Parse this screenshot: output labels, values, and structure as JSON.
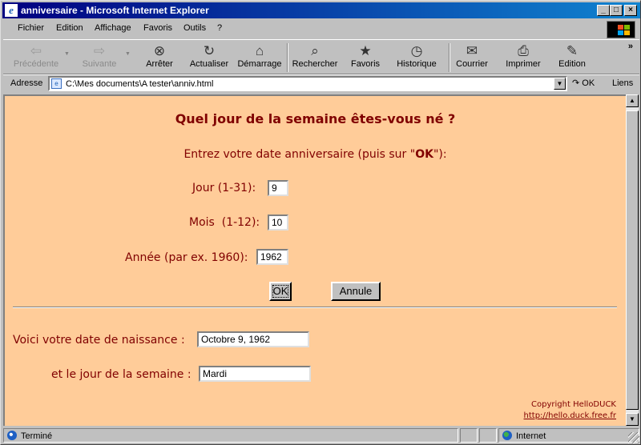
{
  "window": {
    "title": "anniversaire - Microsoft Internet Explorer",
    "minimize": "_",
    "maximize": "□",
    "close": "×"
  },
  "menu": {
    "file": "Fichier",
    "edit": "Edition",
    "view": "Affichage",
    "favorites": "Favoris",
    "tools": "Outils",
    "help": "?"
  },
  "toolbar": {
    "back": "Précédente",
    "forward": "Suivante",
    "stop": "Arrêter",
    "refresh": "Actualiser",
    "home": "Démarrage",
    "search": "Rechercher",
    "favorites": "Favoris",
    "history": "Historique",
    "mail": "Courrier",
    "print": "Imprimer",
    "edit": "Edition",
    "more": "»"
  },
  "address": {
    "label": "Adresse",
    "value": "C:\\Mes documents\\A tester\\anniv.html",
    "go": "OK",
    "links": "Liens"
  },
  "page": {
    "heading": "Quel jour de la semaine êtes-vous né ?",
    "instruction_pre": "Entrez votre date anniversaire (puis sur \"",
    "instruction_ok": "OK",
    "instruction_post": "\"):",
    "day_label": "Jour (1-31):",
    "day_value": "9",
    "month_label": "Mois  (1-12):",
    "month_value": "10",
    "year_label": "Année (par ex. 1960):",
    "year_value": "1962",
    "ok_button": "OK",
    "cancel_button": "Annule",
    "result_date_label": "Voici votre date de naissance :",
    "result_date_value": "Octobre 9, 1962",
    "result_day_label": "et le jour de la semaine :",
    "result_day_value": "Mardi",
    "copyright": "Copyright HelloDUCK",
    "copyright_link": "http://hello.duck.free.fr"
  },
  "status": {
    "text": "Terminé",
    "zone": "Internet"
  },
  "colors": {
    "page_background": "#ffcc99",
    "text": "#800000",
    "titlebar": "#000080"
  },
  "icons": [
    "ie-page-icon",
    "back-arrow-icon",
    "forward-arrow-icon",
    "stop-icon",
    "refresh-icon",
    "home-icon",
    "search-icon",
    "favorites-icon",
    "history-icon",
    "mail-icon",
    "print-icon",
    "edit-icon",
    "globe-icon"
  ]
}
